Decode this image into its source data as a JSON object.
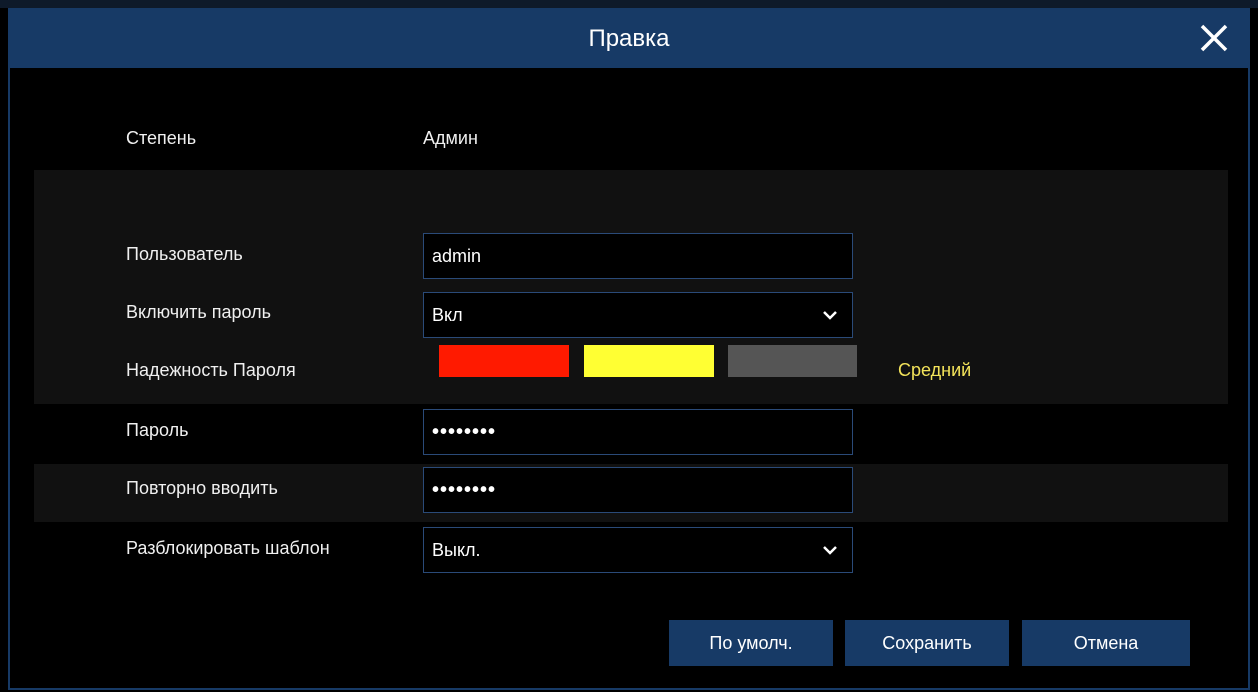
{
  "dialog": {
    "title": "Правка"
  },
  "rows": {
    "level": {
      "label": "Степень",
      "value": "Админ"
    },
    "user": {
      "label": "Пользователь",
      "value": "admin"
    },
    "enable_password": {
      "label": "Включить пароль",
      "value": "Вкл"
    },
    "strength": {
      "label": "Надежность Пароля",
      "text": "Средний",
      "colors": [
        "#ff1a00",
        "#ffff33",
        "#555555"
      ]
    },
    "password": {
      "label": "Пароль",
      "value": "••••••••"
    },
    "repeat": {
      "label": "Повторно вводить",
      "value": "••••••••"
    },
    "unlock_pattern": {
      "label": "Разблокировать шаблон",
      "value": "Выкл."
    }
  },
  "buttons": {
    "default": "По умолч.",
    "save": "Сохранить",
    "cancel": "Отмена"
  },
  "icons": {
    "close": "close-icon",
    "dropdown": "chevron-down-icon"
  }
}
